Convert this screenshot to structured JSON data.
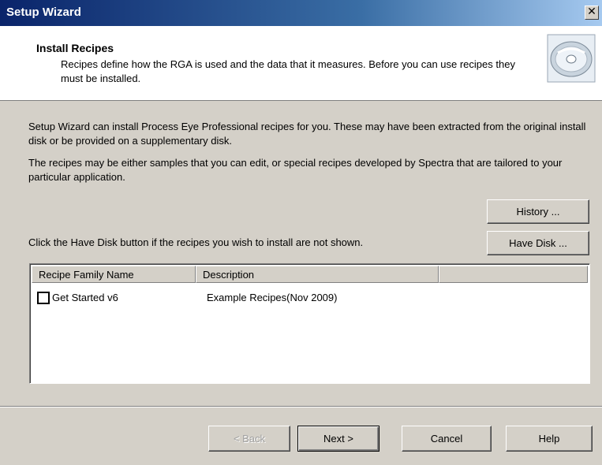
{
  "window": {
    "title": "Setup Wizard",
    "close_glyph": "✕"
  },
  "header": {
    "title": "Install Recipes",
    "description": "Recipes define how the RGA is used and the data that it measures.  Before you can use recipes they must be installed.",
    "icon": "cd-disc-icon"
  },
  "body": {
    "paragraph1": "Setup Wizard can install Process Eye Professional recipes for you.  These may have been extracted from the original install disk or be provided on a supplementary disk.",
    "paragraph2": "The recipes may be either samples that you can edit, or special recipes developed by Spectra that are tailored to your particular application.",
    "have_disk_hint": "Click the Have Disk button if the recipes you wish to install are not shown.",
    "history_label": "History ...",
    "have_disk_label": "Have Disk ..."
  },
  "recipes": {
    "columns": [
      "Recipe Family Name",
      "Description",
      ""
    ],
    "rows": [
      {
        "name": "Get Started v6",
        "description": "Example Recipes(Nov 2009)",
        "checked": false
      }
    ]
  },
  "footer": {
    "back_label": "< Back",
    "next_label": "Next >",
    "cancel_label": "Cancel",
    "help_label": "Help",
    "back_enabled": false,
    "default_button": "next"
  },
  "colors": {
    "face": "#d4d0c8",
    "titlebar_start": "#0a246a",
    "titlebar_end": "#a6caf0"
  }
}
